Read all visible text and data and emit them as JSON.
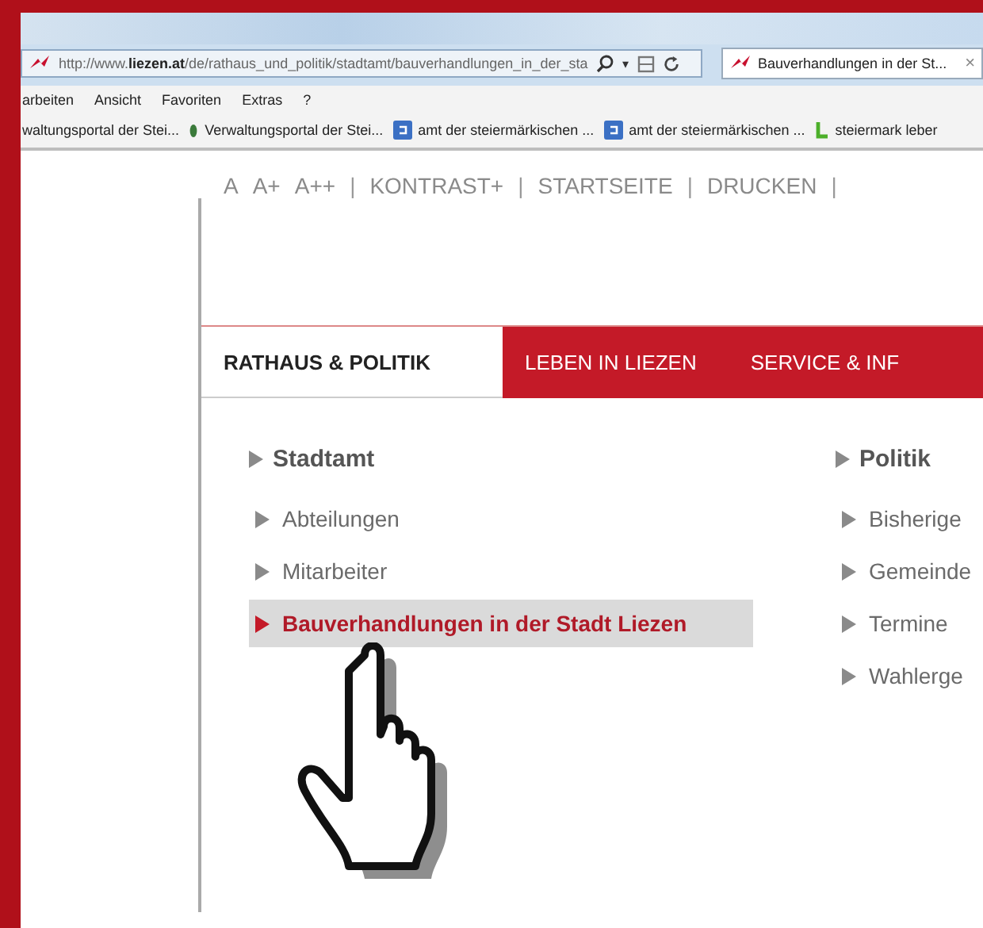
{
  "address_bar": {
    "url": "http://www.**liezen.at**/de/rathaus_und_politik/stadtamt/bauverhandlungen_in_der_sta",
    "dropdown": "▾"
  },
  "browser_tab": {
    "title": "Bauverhandlungen in der St...",
    "close": "×",
    "selected": true
  },
  "menu_bar": [
    "arbeiten",
    "Ansicht",
    "Favoriten",
    "Extras",
    "?"
  ],
  "favorites_bar": [
    {
      "label": "waltungsportal der Stei...",
      "kind": "plain"
    },
    {
      "label": "Verwaltungsportal der Stei...",
      "kind": "leaf"
    },
    {
      "label": "amt der steiermärkischen ...",
      "kind": "square"
    },
    {
      "label": "amt der steiermärkischen ...",
      "kind": "square"
    },
    {
      "label": "steiermark leber",
      "kind": "letter"
    }
  ],
  "utility_links": [
    {
      "text": "A",
      "kind": "link"
    },
    {
      "text": "A+",
      "kind": "link"
    },
    {
      "text": "A++",
      "kind": "link"
    },
    {
      "text": "|",
      "kind": "separator"
    },
    {
      "text": "KONTRAST+",
      "kind": "link"
    },
    {
      "text": "|",
      "kind": "separator"
    },
    {
      "text": "STARTSEITE",
      "kind": "link"
    },
    {
      "text": "|",
      "kind": "separator"
    },
    {
      "text": "DRUCKEN",
      "kind": "link"
    },
    {
      "text": "|",
      "kind": "separator"
    }
  ],
  "nav_tabs": [
    {
      "label": "RATHAUS & POLITIK",
      "selected": true
    },
    {
      "label": "LEBEN IN LIEZEN",
      "selected": false
    },
    {
      "label": "SERVICE & INF",
      "selected": false
    }
  ],
  "menu_columns": [
    {
      "heading": "Stadtamt",
      "items": [
        {
          "label": "Abteilungen",
          "selected": false
        },
        {
          "label": "Mitarbeiter",
          "selected": false
        },
        {
          "label": "Bauverhandlungen in der Stadt Liezen",
          "selected": true
        }
      ]
    },
    {
      "heading": "Politik",
      "items": [
        {
          "label": "Bisherige",
          "selected": false
        },
        {
          "label": "Gemeinde",
          "selected": false
        },
        {
          "label": "Termine",
          "selected": false
        },
        {
          "label": "Wahlerge",
          "selected": false
        }
      ]
    }
  ]
}
